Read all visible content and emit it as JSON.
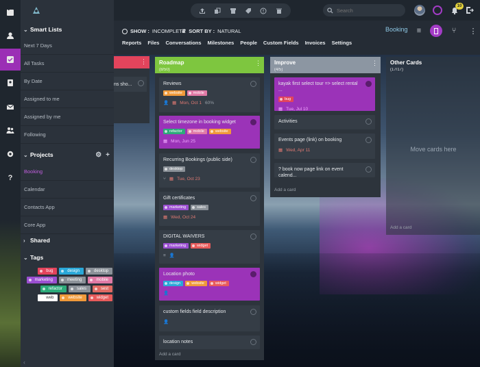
{
  "search": {
    "placeholder": "Search"
  },
  "notifications": {
    "count": "10"
  },
  "sidebar": {
    "smart_lists_title": "Smart Lists",
    "smart_lists": [
      "Next 7 Days",
      "All Tasks",
      "By Date",
      "Assigned to me",
      "Assigned by me",
      "Following"
    ],
    "projects_title": "Projects",
    "projects": [
      "Booking",
      "Calendar",
      "Contacts App",
      "Core App"
    ],
    "shared_title": "Shared",
    "tags_title": "Tags",
    "tags": [
      {
        "label": "bug",
        "color": "#e2445c"
      },
      {
        "label": "design",
        "color": "#2aa8d8"
      },
      {
        "label": "desktop",
        "color": "#8b9198"
      },
      {
        "label": "marketing",
        "color": "#9b4fd1"
      },
      {
        "label": "meeting",
        "color": "#8b9198"
      },
      {
        "label": "mobile",
        "color": "#e07aa6"
      },
      {
        "label": "refactor",
        "color": "#2cab7a"
      },
      {
        "label": "sales",
        "color": "#8b9198"
      },
      {
        "label": "sest",
        "color": "#e06a63"
      },
      {
        "label": "web",
        "color": "#ffffff"
      },
      {
        "label": "website",
        "color": "#f09a3a"
      },
      {
        "label": "widget",
        "color": "#e85b5b"
      }
    ]
  },
  "board": {
    "show_label": "SHOW :",
    "show_value": "INCOMPLETE",
    "sort_label": "SORT BY :",
    "sort_value": "NATURAL",
    "view_name": "Booking",
    "nav": [
      "Reports",
      "Files",
      "Conversations",
      "Milestones",
      "People",
      "Custom Fields",
      "Invoices",
      "Settings"
    ]
  },
  "lists": {
    "first": {
      "partial_card": "ns sho...",
      "color": "#e2445c"
    },
    "roadmap": {
      "title": "Roadmap",
      "count": "(8/50)",
      "color": "#7ec63f",
      "cards": [
        {
          "title": "Reviews",
          "date": "Mon, Oct 1",
          "progress": "60%"
        },
        {
          "title": "Select timezone in booking widget",
          "date": "Mon, Jun 25"
        },
        {
          "title": "Recurring Bookings (public side)",
          "date": "Tue, Oct 23"
        },
        {
          "title": "Gift certificates",
          "date": "Wed, Oct 24"
        },
        {
          "title": "DIGITAL WAIVERS"
        },
        {
          "title": "Location photo"
        },
        {
          "title": "custom fields field description"
        },
        {
          "title": "location notes"
        }
      ],
      "add_card": "Add a card"
    },
    "improve": {
      "title": "Improve",
      "count": "(4/5)",
      "color": "#8c96a2",
      "cards": [
        {
          "title": "kayak first select tour => select rental ...",
          "date": "Tue, Jul 10"
        },
        {
          "title": "Activities"
        },
        {
          "title": "Events page (link) on booking",
          "date": "Wed, Apr 11"
        },
        {
          "title": "? book now page link on event calend..."
        }
      ],
      "add_card": "Add a card"
    },
    "other": {
      "title": "Other Cards",
      "count": "(17/17)",
      "move_here": "Move cards here",
      "add_card": "Add a card"
    }
  },
  "tag_labels": {
    "website": "website",
    "mobile": "mobile",
    "refactor": "refactor",
    "desktop": "desktop",
    "marketing": "marketing",
    "sales": "sales",
    "widget": "widget",
    "design": "design",
    "bug": "bug"
  }
}
